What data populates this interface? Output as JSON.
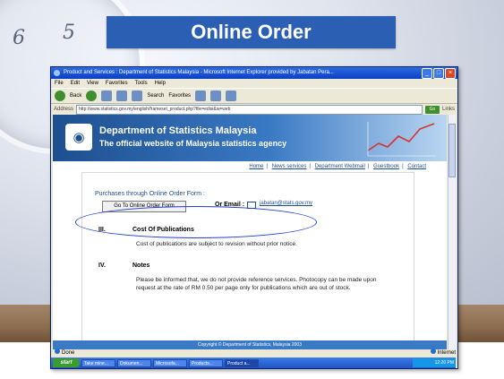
{
  "slide": {
    "title": "Online Order",
    "clock_numbers": [
      "6",
      "5"
    ]
  },
  "window": {
    "title": "Product and Services : Department of Statistics Malaysia - Microsoft Internet Explorer provided by Jabatan Pera...",
    "menu": [
      "File",
      "Edit",
      "View",
      "Favorites",
      "Tools",
      "Help"
    ],
    "toolbar": {
      "back": "Back",
      "search": "Search",
      "favorites": "Favorites"
    },
    "address_label": "Address",
    "address_value": "http://www.statistics.gov.my/english/frameset_product.php?file=edisi&w=web",
    "go": "Go",
    "links": "Links"
  },
  "site": {
    "org": "Department of Statistics Malaysia",
    "tagline": "The official website of Malaysia statistics agency",
    "nav": [
      "Home",
      "News services",
      "Department Webmail",
      "Guestbook",
      "Contact"
    ],
    "purchase_text": "Purchases through Online Order Form :",
    "order_button": "Go To Online Order Form",
    "email_label": "Or Email :",
    "email": "jabatan@stats.gov.my",
    "sections": [
      {
        "num": "III.",
        "heading": "Cost Of Publications",
        "text": "Cost of publications are subject to revision without prior notice."
      },
      {
        "num": "IV.",
        "heading": "Notes",
        "text": "Please be informed that, we do not provide reference services. Photocopy can be made upon request at the rate of RM 0.50 per page only for publications which are out of stock."
      }
    ],
    "copyright": "Copyright © Department of Statistics, Malaysia 2003"
  },
  "status": {
    "left": "Done",
    "right": "Internet"
  },
  "taskbar": {
    "start": "start",
    "items": [
      "Take mine...",
      "Dokumen...",
      "Microsofa...",
      "Products...",
      "Product a..."
    ],
    "clock": "12:20 PM"
  },
  "colors": {
    "title_blue": "#2a5fb4",
    "oval": "#1f3fcf",
    "banner_blue": "#1d4f8f"
  }
}
